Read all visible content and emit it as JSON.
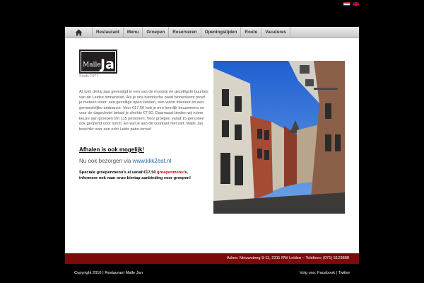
{
  "languages": [
    {
      "icon": "flag-nl-icon",
      "label": "NL"
    },
    {
      "icon": "flag-en-icon",
      "label": "EN"
    }
  ],
  "nav": {
    "home_icon": "home-icon",
    "items": [
      {
        "label": "Restaurant"
      },
      {
        "label": "Menu"
      },
      {
        "label": "Groepen"
      },
      {
        "label": "Reserveren"
      },
      {
        "label": "Openingstijden"
      },
      {
        "label": "Route"
      },
      {
        "label": "Vacatures"
      }
    ]
  },
  "logo": {
    "text": "Malle Jan",
    "tagline": "Sinds 1977"
  },
  "content": {
    "intro": "Al ruim dertig jaar gevestigd in een van de mooiste en gezelligste buurtjes van de Leidse binnenstad. Als je ons historische pand binnenkomt proef je meteen sfeer: een gezellige open keuken, een warm interieur en een gemoedelijke ambiance. Voor €17,50 heb je een heerlijk keuzemenu en voor de dagschotel betaal je slechts €7,50. Daarnaast bieden wij ruime keuze aan groepen t/m 115 personen. Voor groepen vanaf 15 personen ook geopend voor lunch. En wat je aan de voorkant niet ziet: Malle Jan beschikt over een echt Leids patio-terras!",
    "afhalen": "Afhalen is ook mogelijk!",
    "bezorgen_prefix": "Nu ook bezorgen via ",
    "bezorgen_link": "www.klik2eat.nl",
    "group_line1_a": "Speciale groepenmenu's al vanaf €17,50 ",
    "group_line1_link": "groepenmenu",
    "group_line1_b": "'s,",
    "group_line2": "informeer ook naar onze biertap aanbieding voor groepen!"
  },
  "footer": {
    "address": "Adres: Nieuwsteeg 9-11, 2311 RW Leiden – Telefoon: (071) 5123888",
    "copyright": "Copyright 2016 | Restaurant Malle Jan",
    "social_prefix": "Volg ons: ",
    "facebook": "Facebook",
    "separator": " | ",
    "twitter": "Twitter"
  },
  "colors": {
    "footer_bar": "#7d0a0a",
    "link": "#1f6aa5",
    "highlight": "#c00000"
  }
}
